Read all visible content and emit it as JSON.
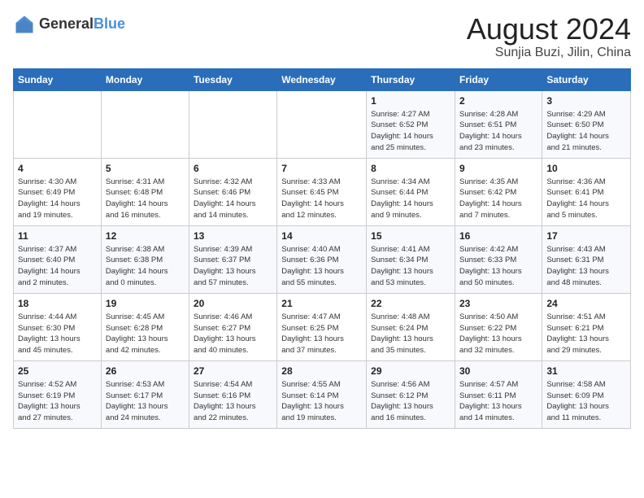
{
  "header": {
    "logo_general": "General",
    "logo_blue": "Blue",
    "month": "August 2024",
    "location": "Sunjia Buzi, Jilin, China"
  },
  "weekdays": [
    "Sunday",
    "Monday",
    "Tuesday",
    "Wednesday",
    "Thursday",
    "Friday",
    "Saturday"
  ],
  "weeks": [
    [
      {
        "day": "",
        "info": ""
      },
      {
        "day": "",
        "info": ""
      },
      {
        "day": "",
        "info": ""
      },
      {
        "day": "",
        "info": ""
      },
      {
        "day": "1",
        "info": "Sunrise: 4:27 AM\nSunset: 6:52 PM\nDaylight: 14 hours\nand 25 minutes."
      },
      {
        "day": "2",
        "info": "Sunrise: 4:28 AM\nSunset: 6:51 PM\nDaylight: 14 hours\nand 23 minutes."
      },
      {
        "day": "3",
        "info": "Sunrise: 4:29 AM\nSunset: 6:50 PM\nDaylight: 14 hours\nand 21 minutes."
      }
    ],
    [
      {
        "day": "4",
        "info": "Sunrise: 4:30 AM\nSunset: 6:49 PM\nDaylight: 14 hours\nand 19 minutes."
      },
      {
        "day": "5",
        "info": "Sunrise: 4:31 AM\nSunset: 6:48 PM\nDaylight: 14 hours\nand 16 minutes."
      },
      {
        "day": "6",
        "info": "Sunrise: 4:32 AM\nSunset: 6:46 PM\nDaylight: 14 hours\nand 14 minutes."
      },
      {
        "day": "7",
        "info": "Sunrise: 4:33 AM\nSunset: 6:45 PM\nDaylight: 14 hours\nand 12 minutes."
      },
      {
        "day": "8",
        "info": "Sunrise: 4:34 AM\nSunset: 6:44 PM\nDaylight: 14 hours\nand 9 minutes."
      },
      {
        "day": "9",
        "info": "Sunrise: 4:35 AM\nSunset: 6:42 PM\nDaylight: 14 hours\nand 7 minutes."
      },
      {
        "day": "10",
        "info": "Sunrise: 4:36 AM\nSunset: 6:41 PM\nDaylight: 14 hours\nand 5 minutes."
      }
    ],
    [
      {
        "day": "11",
        "info": "Sunrise: 4:37 AM\nSunset: 6:40 PM\nDaylight: 14 hours\nand 2 minutes."
      },
      {
        "day": "12",
        "info": "Sunrise: 4:38 AM\nSunset: 6:38 PM\nDaylight: 14 hours\nand 0 minutes."
      },
      {
        "day": "13",
        "info": "Sunrise: 4:39 AM\nSunset: 6:37 PM\nDaylight: 13 hours\nand 57 minutes."
      },
      {
        "day": "14",
        "info": "Sunrise: 4:40 AM\nSunset: 6:36 PM\nDaylight: 13 hours\nand 55 minutes."
      },
      {
        "day": "15",
        "info": "Sunrise: 4:41 AM\nSunset: 6:34 PM\nDaylight: 13 hours\nand 53 minutes."
      },
      {
        "day": "16",
        "info": "Sunrise: 4:42 AM\nSunset: 6:33 PM\nDaylight: 13 hours\nand 50 minutes."
      },
      {
        "day": "17",
        "info": "Sunrise: 4:43 AM\nSunset: 6:31 PM\nDaylight: 13 hours\nand 48 minutes."
      }
    ],
    [
      {
        "day": "18",
        "info": "Sunrise: 4:44 AM\nSunset: 6:30 PM\nDaylight: 13 hours\nand 45 minutes."
      },
      {
        "day": "19",
        "info": "Sunrise: 4:45 AM\nSunset: 6:28 PM\nDaylight: 13 hours\nand 42 minutes."
      },
      {
        "day": "20",
        "info": "Sunrise: 4:46 AM\nSunset: 6:27 PM\nDaylight: 13 hours\nand 40 minutes."
      },
      {
        "day": "21",
        "info": "Sunrise: 4:47 AM\nSunset: 6:25 PM\nDaylight: 13 hours\nand 37 minutes."
      },
      {
        "day": "22",
        "info": "Sunrise: 4:48 AM\nSunset: 6:24 PM\nDaylight: 13 hours\nand 35 minutes."
      },
      {
        "day": "23",
        "info": "Sunrise: 4:50 AM\nSunset: 6:22 PM\nDaylight: 13 hours\nand 32 minutes."
      },
      {
        "day": "24",
        "info": "Sunrise: 4:51 AM\nSunset: 6:21 PM\nDaylight: 13 hours\nand 29 minutes."
      }
    ],
    [
      {
        "day": "25",
        "info": "Sunrise: 4:52 AM\nSunset: 6:19 PM\nDaylight: 13 hours\nand 27 minutes."
      },
      {
        "day": "26",
        "info": "Sunrise: 4:53 AM\nSunset: 6:17 PM\nDaylight: 13 hours\nand 24 minutes."
      },
      {
        "day": "27",
        "info": "Sunrise: 4:54 AM\nSunset: 6:16 PM\nDaylight: 13 hours\nand 22 minutes."
      },
      {
        "day": "28",
        "info": "Sunrise: 4:55 AM\nSunset: 6:14 PM\nDaylight: 13 hours\nand 19 minutes."
      },
      {
        "day": "29",
        "info": "Sunrise: 4:56 AM\nSunset: 6:12 PM\nDaylight: 13 hours\nand 16 minutes."
      },
      {
        "day": "30",
        "info": "Sunrise: 4:57 AM\nSunset: 6:11 PM\nDaylight: 13 hours\nand 14 minutes."
      },
      {
        "day": "31",
        "info": "Sunrise: 4:58 AM\nSunset: 6:09 PM\nDaylight: 13 hours\nand 11 minutes."
      }
    ]
  ]
}
